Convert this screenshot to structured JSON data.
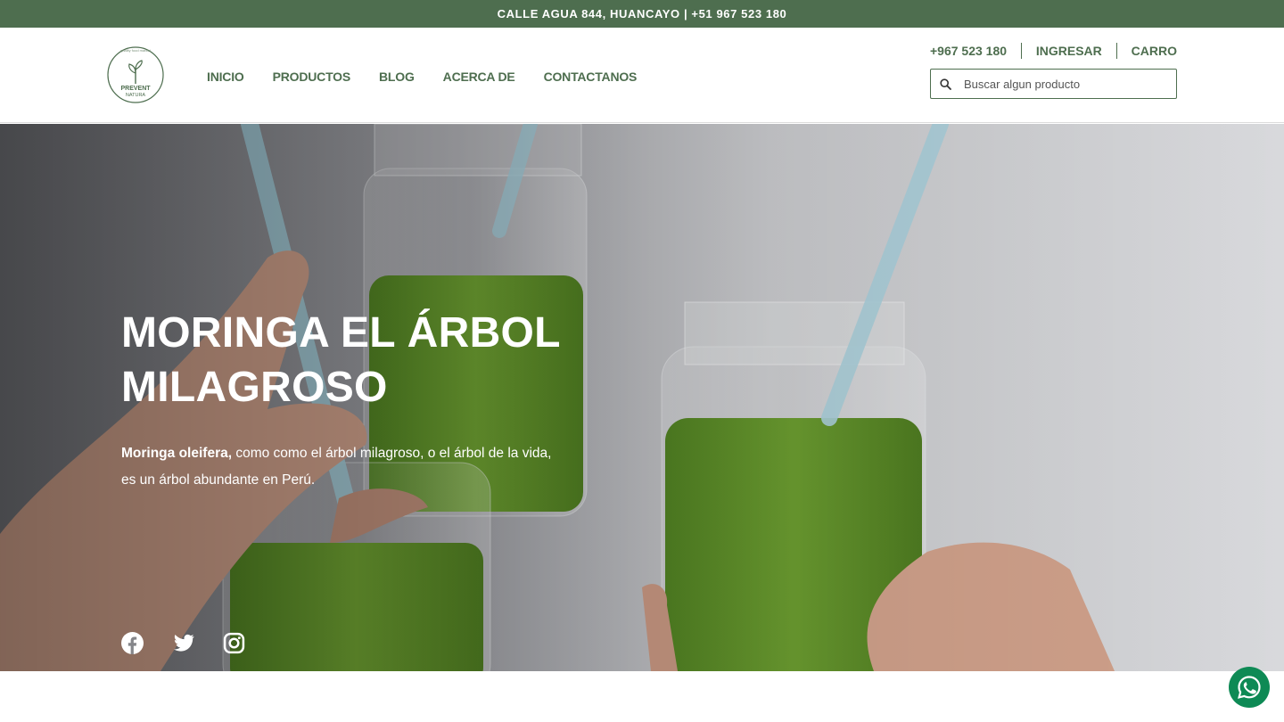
{
  "topbar": {
    "text": "CALLE AGUA 844, HUANCAYO | +51 967 523 180"
  },
  "logo": {
    "tagline": "quality food market",
    "name_line1": "PREVENT",
    "name_line2": "NATURA"
  },
  "nav": {
    "items": [
      "INICIO",
      "PRODUCTOS",
      "BLOG",
      "ACERCA DE",
      "CONTACTANOS"
    ]
  },
  "header_right": {
    "phone": "+967 523 180",
    "login": "INGRESAR",
    "cart": "CARRO",
    "search_placeholder": "Buscar algun producto"
  },
  "hero": {
    "title_line1": "MORINGA EL ÁRBOL",
    "title_line2": "MILAGROSO",
    "text_bold": "Moringa oleifera,",
    "text_rest": " como como el árbol milagroso, o el árbol de la vida,",
    "text_line2": "es un árbol abundante en Perú."
  },
  "social": {
    "icons": [
      "facebook-icon",
      "twitter-icon",
      "instagram-icon"
    ]
  },
  "colors": {
    "brand_green": "#4e6e4f",
    "whatsapp": "#0e8a55",
    "smoothie": "#5f8f2c"
  }
}
